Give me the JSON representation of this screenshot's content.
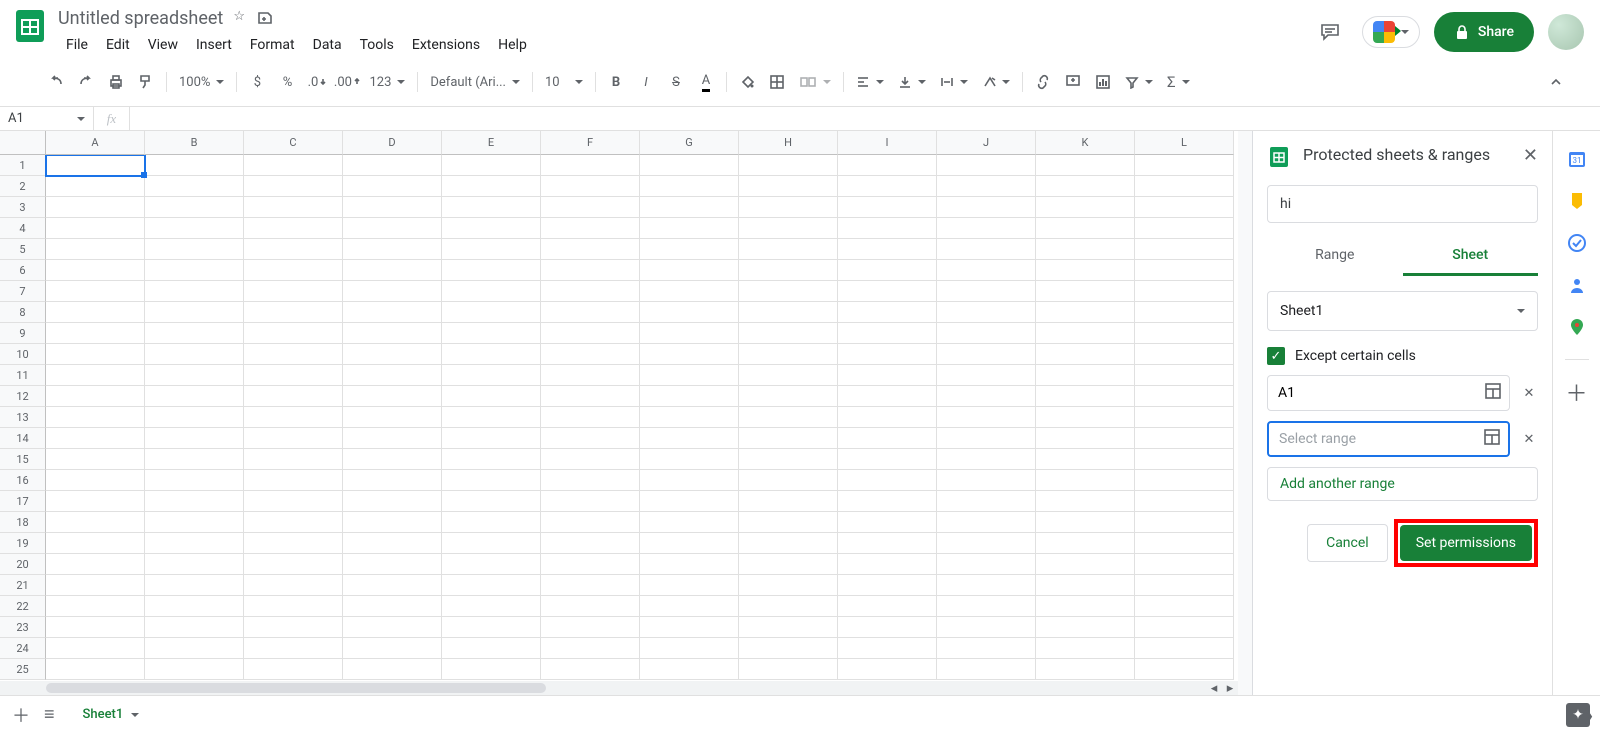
{
  "header": {
    "doc_title": "Untitled spreadsheet",
    "menus": [
      "File",
      "Edit",
      "View",
      "Insert",
      "Format",
      "Data",
      "Tools",
      "Extensions",
      "Help"
    ],
    "share_label": "Share"
  },
  "toolbar": {
    "zoom": "100%",
    "currency": "$",
    "percent": "%",
    "dec_dec": ".0",
    "inc_dec": ".00",
    "more_formats": "123",
    "font": "Default (Ari...",
    "font_size": "10"
  },
  "formula_bar": {
    "cell_ref": "A1",
    "fx_label": "fx"
  },
  "grid": {
    "columns": [
      "A",
      "B",
      "C",
      "D",
      "E",
      "F",
      "G",
      "H",
      "I",
      "J",
      "K",
      "L"
    ],
    "row_count": 25
  },
  "sidepanel": {
    "title": "Protected sheets & ranges",
    "description_value": "hi",
    "tabs": {
      "range": "Range",
      "sheet": "Sheet",
      "active": "sheet"
    },
    "sheet_select": "Sheet1",
    "except_label": "Except certain cells",
    "except_checked": true,
    "ranges": [
      "A1"
    ],
    "range_placeholder": "Select range",
    "add_another": "Add another range",
    "cancel": "Cancel",
    "set_permissions": "Set permissions"
  },
  "tabs": {
    "sheet1": "Sheet1"
  }
}
